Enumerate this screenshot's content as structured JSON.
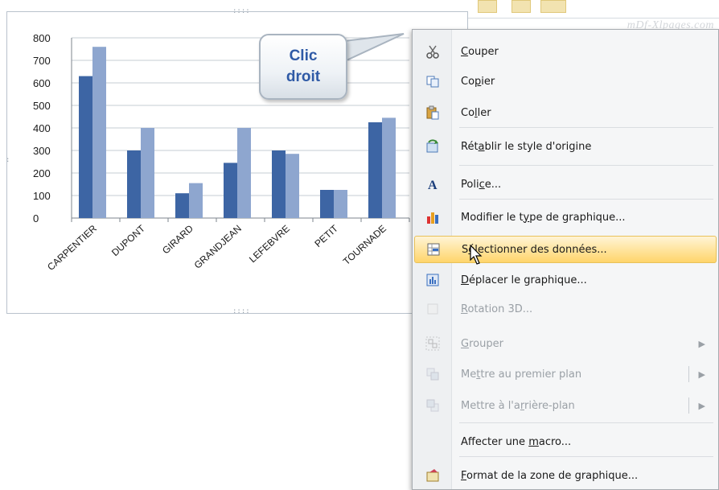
{
  "watermark": "mDf-Xlpages.com",
  "callout": {
    "line1": "Clic",
    "line2": "droit"
  },
  "chart_data": {
    "type": "bar",
    "categories": [
      "CARPENTIER",
      "DUPONT",
      "GIRARD",
      "GRANDJEAN",
      "LEFEBVRE",
      "PETIT",
      "TOURNADE"
    ],
    "series": [
      {
        "values": [
          630,
          300,
          110,
          245,
          300,
          125,
          425
        ]
      },
      {
        "values": [
          760,
          400,
          155,
          400,
          285,
          125,
          445
        ]
      }
    ],
    "ylim": [
      0,
      800
    ],
    "yticks": [
      0,
      100,
      200,
      300,
      400,
      500,
      600,
      700,
      800
    ],
    "grid": true,
    "colors": [
      "#3d65a4",
      "#8ea6cf"
    ]
  },
  "menu": {
    "items": [
      {
        "id": "couper",
        "pre": "",
        "acc": "C",
        "post": "ouper",
        "icon": "scissors-icon",
        "disabled": false,
        "submenu": false
      },
      {
        "id": "copier",
        "pre": "Co",
        "acc": "p",
        "post": "ier",
        "icon": "copy-icon",
        "disabled": false,
        "submenu": false
      },
      {
        "id": "coller",
        "pre": "Co",
        "acc": "l",
        "post": "ler",
        "icon": "paste-icon",
        "disabled": false,
        "submenu": false
      },
      {
        "id": "retablir",
        "pre": "Rét",
        "acc": "a",
        "post": "blir le style d'origine",
        "icon": "reset-style-icon",
        "disabled": false,
        "submenu": false
      },
      {
        "id": "police",
        "pre": "Poli",
        "acc": "c",
        "post": "e...",
        "icon": "font-icon",
        "disabled": false,
        "submenu": false
      },
      {
        "id": "modifier-type",
        "pre": "Modifier le t",
        "acc": "y",
        "post": "pe de graphique...",
        "icon": "chart-type-icon",
        "disabled": false,
        "submenu": false
      },
      {
        "id": "selectionner",
        "pre": "S",
        "acc": "é",
        "post": "lectionner des données...",
        "icon": "select-data-icon",
        "disabled": false,
        "submenu": false,
        "highlighted": true
      },
      {
        "id": "deplacer",
        "pre": "",
        "acc": "D",
        "post": "éplacer le graphique...",
        "icon": "move-chart-icon",
        "disabled": false,
        "submenu": false
      },
      {
        "id": "rotation",
        "pre": "",
        "acc": "R",
        "post": "otation 3D...",
        "icon": "rotation-3d-icon",
        "disabled": true,
        "submenu": false
      },
      {
        "id": "grouper",
        "pre": "",
        "acc": "G",
        "post": "rouper",
        "icon": "group-icon",
        "disabled": true,
        "submenu": true
      },
      {
        "id": "premier-plan",
        "pre": "Me",
        "acc": "t",
        "post": "tre au premier plan",
        "icon": "bring-front-icon",
        "disabled": true,
        "submenu": true
      },
      {
        "id": "arriere-plan",
        "pre": "Mettre à l'a",
        "acc": "r",
        "post": "rière-plan",
        "icon": "send-back-icon",
        "disabled": true,
        "submenu": true
      },
      {
        "id": "macro",
        "pre": "Affecter une ",
        "acc": "m",
        "post": "acro...",
        "icon": "none",
        "disabled": false,
        "submenu": false
      },
      {
        "id": "format-zone",
        "pre": "",
        "acc": "F",
        "post": "ormat de la zone de graphique...",
        "icon": "format-chart-area-icon",
        "disabled": false,
        "submenu": false
      }
    ]
  }
}
